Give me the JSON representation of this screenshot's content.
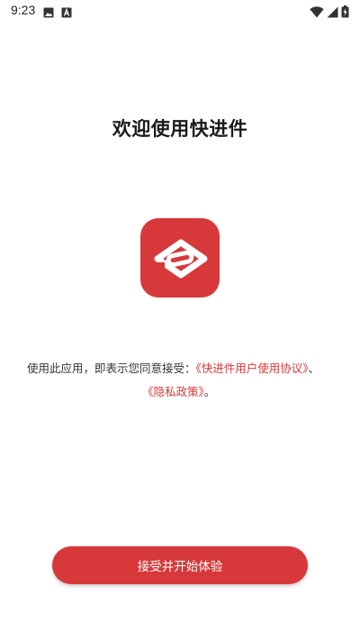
{
  "status_bar": {
    "time": "9:23",
    "left_icons": [
      "image-icon",
      "a-notification-icon"
    ],
    "right_icons": [
      "wifi-icon",
      "signal-icon",
      "battery-charging-icon"
    ]
  },
  "main": {
    "title": "欢迎使用快进件",
    "logo_icon": "app-logo-icon",
    "agreement": {
      "prefix": "使用此应用，即表示您同意接受：",
      "user_agreement_link": "《快进件用户使用协议》",
      "separator": "、",
      "privacy_policy_link": "《隐私政策》",
      "suffix": "。"
    },
    "accept_button_label": "接受并开始体验"
  },
  "colors": {
    "accent": "#d7393a",
    "background": "#ffffff",
    "text": "#333333"
  }
}
